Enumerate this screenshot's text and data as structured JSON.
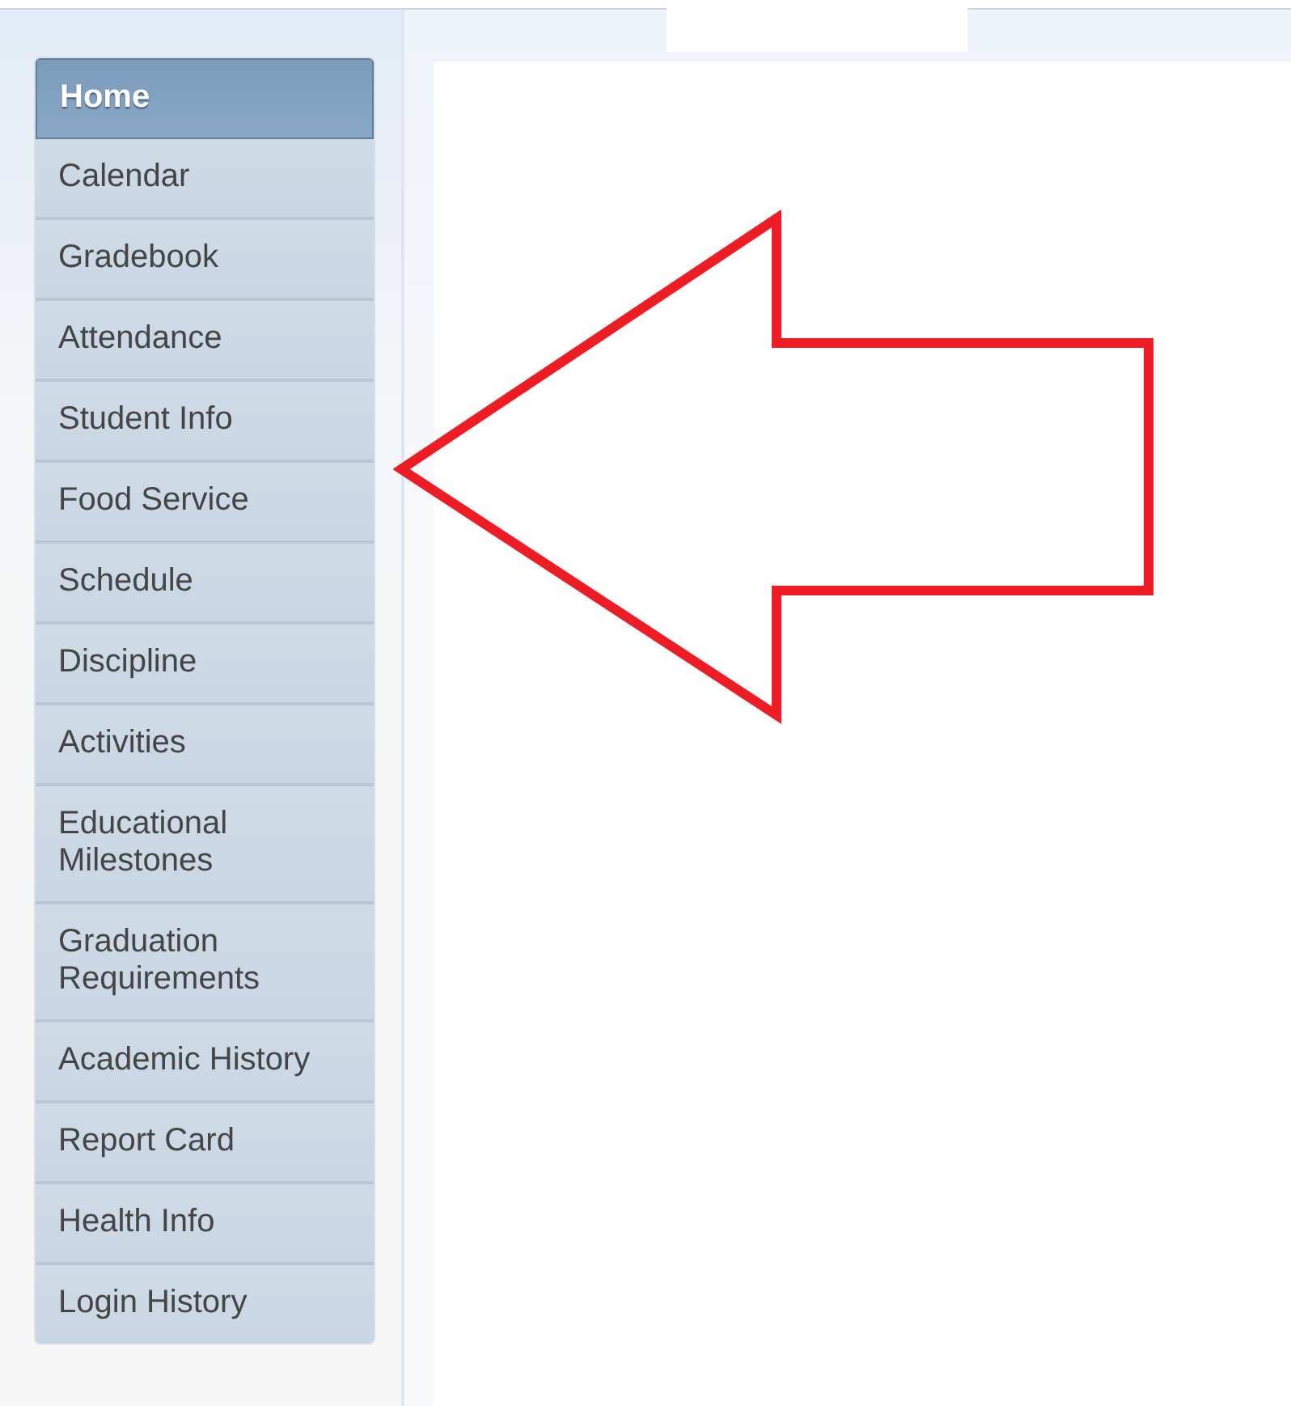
{
  "sidebar": {
    "items": [
      {
        "label": "Home",
        "selected": true
      },
      {
        "label": "Calendar",
        "selected": false
      },
      {
        "label": "Gradebook",
        "selected": false
      },
      {
        "label": "Attendance",
        "selected": false
      },
      {
        "label": "Student Info",
        "selected": false
      },
      {
        "label": "Food Service",
        "selected": false
      },
      {
        "label": "Schedule",
        "selected": false
      },
      {
        "label": "Discipline",
        "selected": false
      },
      {
        "label": "Activities",
        "selected": false
      },
      {
        "label": "Educational Milestones",
        "selected": false
      },
      {
        "label": "Graduation Requirements",
        "selected": false
      },
      {
        "label": "Academic History",
        "selected": false
      },
      {
        "label": "Report Card",
        "selected": false
      },
      {
        "label": "Health Info",
        "selected": false
      },
      {
        "label": "Login History",
        "selected": false
      }
    ]
  }
}
